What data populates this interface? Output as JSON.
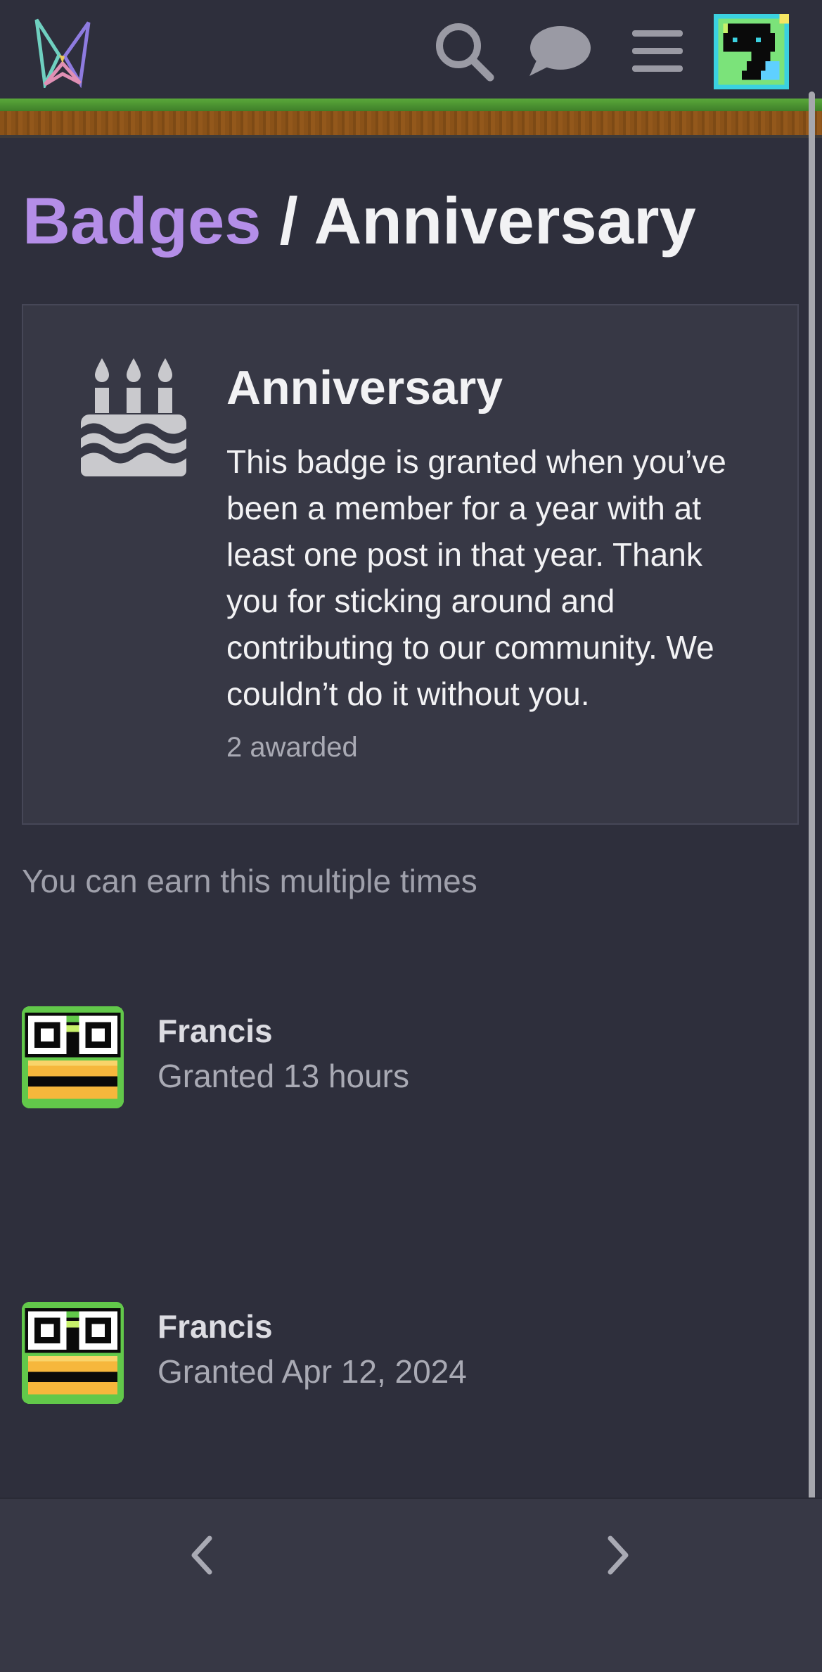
{
  "header": {
    "logo": "site-logo",
    "icons": [
      "search-icon",
      "chat-icon",
      "hamburger-menu-icon"
    ],
    "avatar": "user-avatar"
  },
  "breadcrumb": {
    "parent": "Badges",
    "separator": " / ",
    "current": "Anniversary"
  },
  "badge": {
    "icon": "birthday-cake-icon",
    "name": "Anniversary",
    "description": "This badge is granted when you’ve been a member for a year with at least one post in that year. Thank you for sticking around and contributing to our community. We couldn’t do it without you.",
    "awarded": "2 awarded"
  },
  "earn_note": "You can earn this multiple times",
  "grants": [
    {
      "user": "Francis",
      "time": "Granted 13 hours"
    },
    {
      "user": "Francis",
      "time": "Granted Apr 12, 2024"
    }
  ],
  "footer": {
    "icons": [
      "chevron-left-icon",
      "chevron-right-icon"
    ]
  },
  "colors": {
    "background": "#2e2f3c",
    "card": "#373845",
    "accent": "#b48ee8",
    "muted": "#a9aab4"
  }
}
